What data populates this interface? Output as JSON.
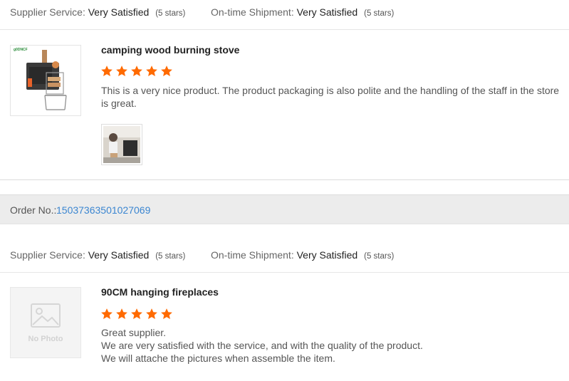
{
  "rating_bar_1": {
    "supplier_label": "Supplier Service:",
    "supplier_value": "Very Satisfied",
    "supplier_stars": "(5 stars)",
    "shipment_label": "On-time Shipment:",
    "shipment_value": "Very Satisfied",
    "shipment_stars": "(5 stars)"
  },
  "review_1": {
    "title": "camping wood burning stove",
    "rating": 5,
    "text": "This is a very nice product.  The product packaging is also polite and the handling of the staff in the store is great.",
    "thumb_logo": "g0DNCF",
    "thumb_icon": "wood-stove-icon",
    "photo_icon": "photo-icon"
  },
  "order": {
    "label": "Order No.:",
    "number": "15037363501027069"
  },
  "rating_bar_2": {
    "supplier_label": "Supplier Service:",
    "supplier_value": "Very Satisfied",
    "supplier_stars": "(5 stars)",
    "shipment_label": "On-time Shipment:",
    "shipment_value": "Very Satisfied",
    "shipment_stars": "(5 stars)"
  },
  "review_2": {
    "title": "90CM hanging fireplaces",
    "rating": 5,
    "lines": [
      "Great supplier.",
      "We are very satisfied with the service, and with the quality of the product.",
      "We will attache the pictures when assemble the item."
    ],
    "no_photo": "No Photo",
    "placeholder_icon": "image-placeholder-icon"
  },
  "colors": {
    "star": "#ff6a00",
    "link": "#3b86d1",
    "order_bg": "#ececec"
  }
}
